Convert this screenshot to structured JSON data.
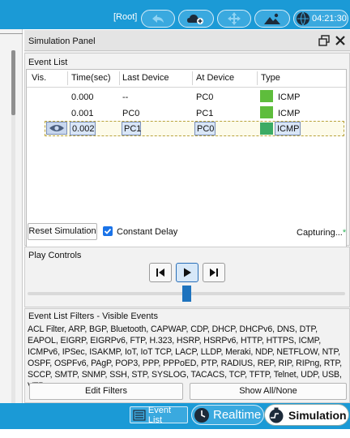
{
  "topbar": {
    "root_label": "[Root]",
    "clock_time": "04:21:30",
    "accent": "#1b9ad6"
  },
  "panel": {
    "title": "Simulation Panel",
    "icons": [
      "float-window-icon",
      "close-icon"
    ]
  },
  "event_list": {
    "section_title": "Event List",
    "columns": [
      "Vis.",
      "Time(sec)",
      "Last Device",
      "At Device",
      "Type"
    ],
    "rows": [
      {
        "time": "0.000",
        "last_device": "--",
        "at_device": "PC0",
        "type": "ICMP",
        "color": "#5ebd3c"
      },
      {
        "time": "0.001",
        "last_device": "PC0",
        "at_device": "PC1",
        "type": "ICMP",
        "color": "#5ebd3c"
      },
      {
        "time": "0.002",
        "last_device": "PC1",
        "at_device": "PC0",
        "type": "ICMP",
        "color": "#3cab64",
        "visible": true,
        "selected": true
      }
    ],
    "reset_button": "Reset Simulation",
    "constant_delay_label": "Constant Delay",
    "constant_delay_checked": true,
    "capturing_text": "Capturing...",
    "capturing_star": "*"
  },
  "play_controls": {
    "section_title": "Play Controls",
    "buttons": [
      "step-back-icon",
      "play-icon",
      "step-forward-icon"
    ],
    "speed_fraction": 0.5
  },
  "filters": {
    "section_title": "Event List Filters - Visible Events",
    "text": "ACL Filter, ARP, BGP, Bluetooth, CAPWAP, CDP, DHCP, DHCPv6, DNS, DTP, EAPOL, EIGRP, EIGRPv6, FTP, H.323, HSRP, HSRPv6, HTTP, HTTPS, ICMP, ICMPv6, IPSec, ISAKMP, IoT, IoT TCP, LACP, LLDP, Meraki, NDP, NETFLOW, NTP, OSPF, OSPFv6, PAgP, POP3, PPP, PPPoED, PTP, RADIUS, REP, RIP, RIPng, RTP, SCCP, SMTP, SNMP, SSH, STP, SYSLOG, TACACS, TCP, TFTP, Telnet, UDP, USB, VTP",
    "edit_button": "Edit Filters",
    "show_button": "Show All/None"
  },
  "bottombar": {
    "event_list_label": "Event List",
    "realtime_label": "Realtime",
    "simulation_label": "Simulation"
  }
}
